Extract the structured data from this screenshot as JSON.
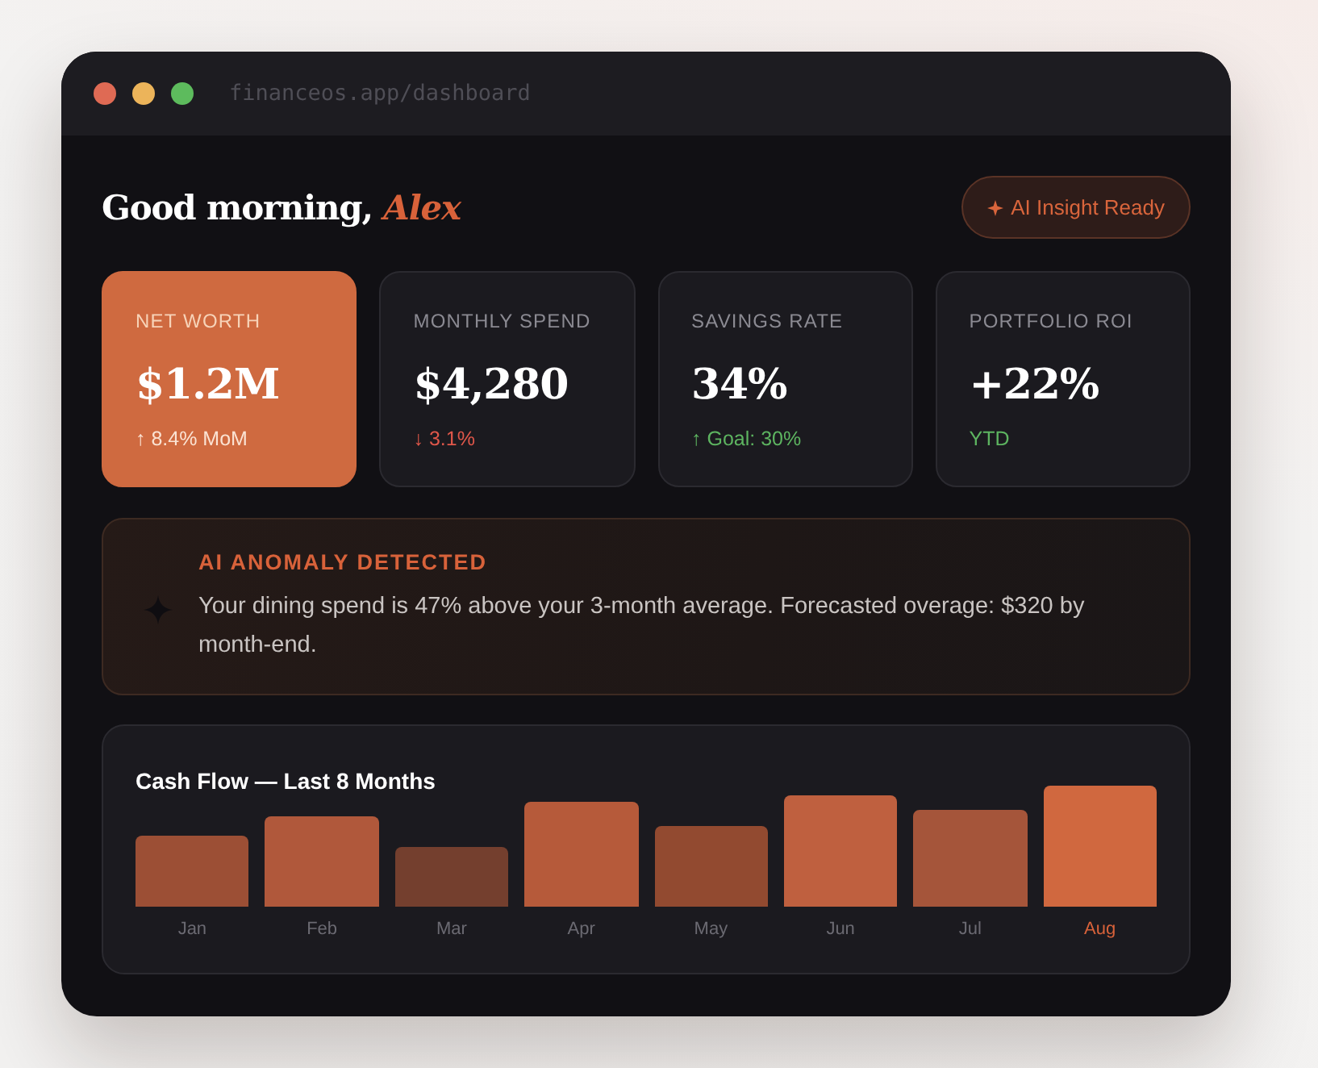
{
  "window": {
    "url": "financeos.app/dashboard"
  },
  "header": {
    "greeting": "Good morning, *Alex*",
    "insight_button": "AI Insight Ready"
  },
  "stats": [
    {
      "label": "NET WORTH",
      "value": "$1.2M",
      "change": "↑ 8.4% MoM",
      "kind": "rise",
      "featured": true
    },
    {
      "label": "MONTHLY SPEND",
      "value": "$4,280",
      "change": "↓ 3.1%",
      "kind": "fall",
      "featured": false
    },
    {
      "label": "SAVINGS RATE",
      "value": "34%",
      "change": "↑ Goal: 30%",
      "kind": "rise",
      "featured": false
    },
    {
      "label": "PORTFOLIO ROI",
      "value": "+22%",
      "change": "YTD",
      "kind": "rise",
      "featured": false
    }
  ],
  "anomaly": {
    "title": "AI ANOMALY DETECTED",
    "message": "Your dining spend is 47% above your 3-month average. Forecasted overage: $320 by month-end."
  },
  "cash_flow": {
    "title": "Cash Flow — Last 8 Months",
    "months": [
      {
        "label": "Jan",
        "selected": false
      },
      {
        "label": "Feb",
        "selected": false
      },
      {
        "label": "Mar",
        "selected": false
      },
      {
        "label": "Apr",
        "selected": false
      },
      {
        "label": "May",
        "selected": false
      },
      {
        "label": "Jun",
        "selected": false
      },
      {
        "label": "Jul",
        "selected": false
      },
      {
        "label": "Aug",
        "selected": true
      }
    ]
  }
}
